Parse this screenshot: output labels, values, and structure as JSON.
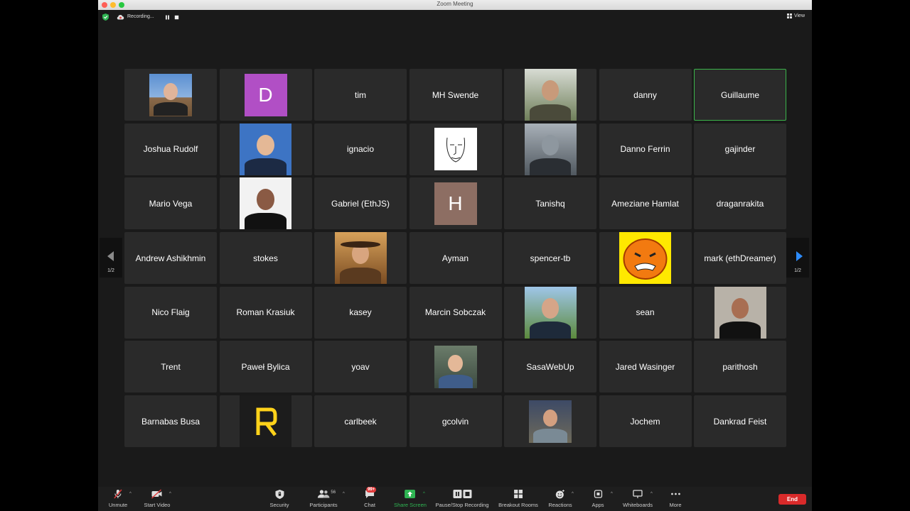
{
  "window": {
    "title": "Zoom Meeting"
  },
  "recording": {
    "status": "Recording..."
  },
  "view": {
    "label": "View"
  },
  "gallery": {
    "tiles": [
      {
        "type": "photo",
        "photo": "man-glasses-outdoor"
      },
      {
        "type": "letter",
        "letter": "D",
        "color": "#b14fc5"
      },
      {
        "type": "name",
        "name": "tim"
      },
      {
        "type": "name",
        "name": "MH Swende"
      },
      {
        "type": "photo",
        "photo": "man-outdoor"
      },
      {
        "type": "name",
        "name": "danny"
      },
      {
        "type": "name",
        "name": "Guillaume",
        "active": true
      },
      {
        "type": "name",
        "name": "Joshua Rudolf"
      },
      {
        "type": "photo",
        "photo": "man-blue-background"
      },
      {
        "type": "name",
        "name": "ignacio"
      },
      {
        "type": "photo",
        "photo": "sketch-face"
      },
      {
        "type": "photo",
        "photo": "robot-helmet"
      },
      {
        "type": "name",
        "name": "Danno Ferrin"
      },
      {
        "type": "name",
        "name": "gajinder"
      },
      {
        "type": "name",
        "name": "Mario Vega"
      },
      {
        "type": "photo",
        "photo": "woman-dark-hair"
      },
      {
        "type": "name",
        "name": "Gabriel (EthJS)"
      },
      {
        "type": "letter",
        "letter": "H",
        "color": "#8d6e63"
      },
      {
        "type": "name",
        "name": "Tanishq"
      },
      {
        "type": "name",
        "name": "Ameziane Hamlat"
      },
      {
        "type": "name",
        "name": "draganrakita"
      },
      {
        "type": "name",
        "name": "Andrew Ashikhmin"
      },
      {
        "type": "name",
        "name": "stokes"
      },
      {
        "type": "photo",
        "photo": "man-cowboy-hat"
      },
      {
        "type": "name",
        "name": "Ayman"
      },
      {
        "type": "name",
        "name": "spencer-tb"
      },
      {
        "type": "photo",
        "photo": "angry-pumpkin"
      },
      {
        "type": "name",
        "name": "mark (ethDreamer)"
      },
      {
        "type": "name",
        "name": "Nico Flaig"
      },
      {
        "type": "name",
        "name": "Roman Krasiuk"
      },
      {
        "type": "name",
        "name": "kasey"
      },
      {
        "type": "name",
        "name": "Marcin Sobczak"
      },
      {
        "type": "photo",
        "photo": "man-trees"
      },
      {
        "type": "name",
        "name": "sean"
      },
      {
        "type": "photo",
        "photo": "woman-blazer"
      },
      {
        "type": "name",
        "name": "Trent"
      },
      {
        "type": "name",
        "name": "Paweł Bylica"
      },
      {
        "type": "name",
        "name": "yoav"
      },
      {
        "type": "photo",
        "photo": "man-smiling"
      },
      {
        "type": "name",
        "name": "SasaWebUp"
      },
      {
        "type": "name",
        "name": "Jared Wasinger"
      },
      {
        "type": "name",
        "name": "parithosh"
      },
      {
        "type": "name",
        "name": "Barnabas Busa"
      },
      {
        "type": "photo",
        "photo": "yellow-letter-r"
      },
      {
        "type": "name",
        "name": "carlbeek"
      },
      {
        "type": "name",
        "name": "gcolvin"
      },
      {
        "type": "photo",
        "photo": "man-beard"
      },
      {
        "type": "name",
        "name": "Jochem"
      },
      {
        "type": "name",
        "name": "Dankrad Feist"
      }
    ]
  },
  "pagination": {
    "left": "1/2",
    "right": "1/2"
  },
  "toolbar": {
    "unmute": "Unmute",
    "start_video": "Start Video",
    "security": "Security",
    "participants": "Participants",
    "participants_count": "56",
    "chat": "Chat",
    "chat_badge": "99+",
    "share_screen": "Share Screen",
    "pause_recording": "Pause/Stop Recording",
    "breakout_rooms": "Breakout Rooms",
    "reactions": "Reactions",
    "apps": "Apps",
    "whiteboards": "Whiteboards",
    "more": "More",
    "end": "End"
  },
  "colors": {
    "accent_green": "#3bb54a",
    "end_red": "#d92a2a",
    "share_green": "#2fb553",
    "nav_blue": "#2d8cff"
  }
}
